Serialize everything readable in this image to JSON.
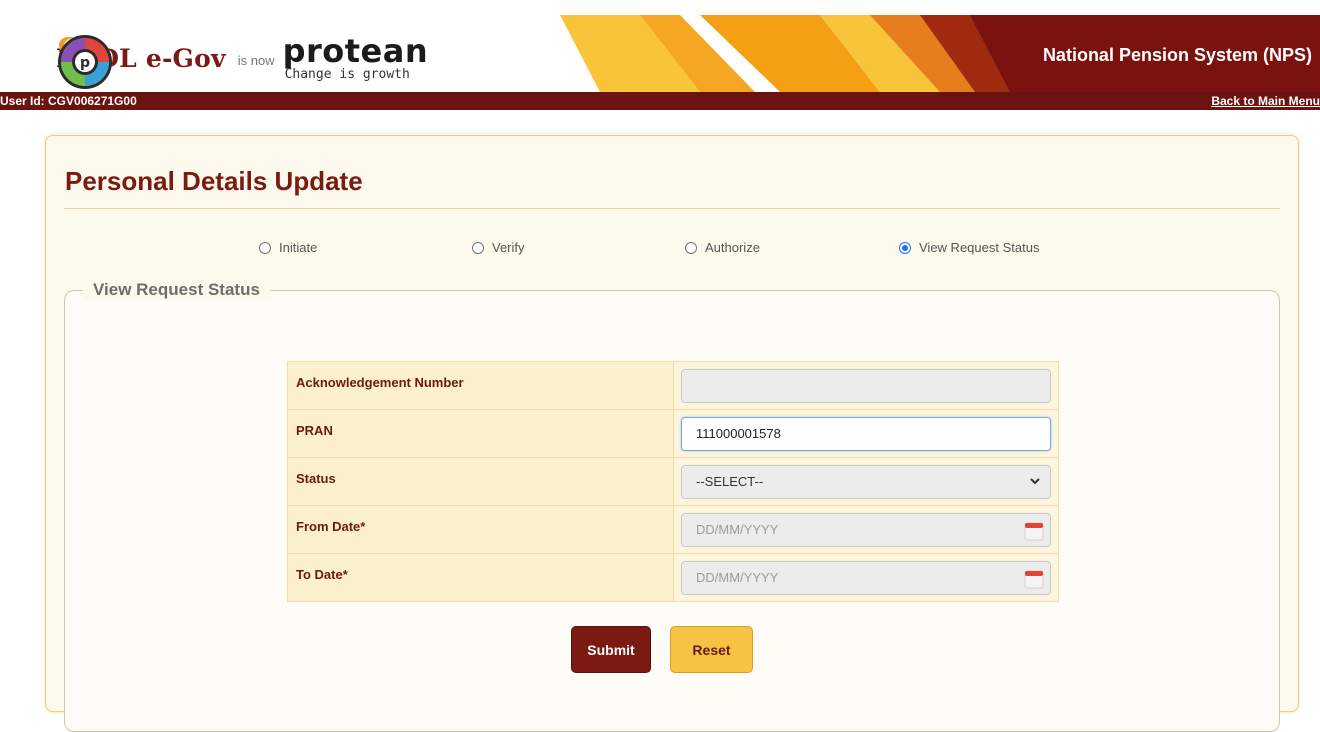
{
  "header": {
    "nsdl_brand_part1": "NSDL ",
    "nsdl_brand_part2": "e-Gov",
    "is_now": "is now",
    "protean_name": "protean",
    "protean_tagline": "Change is growth",
    "system_title": "National Pension System (NPS)"
  },
  "userbar": {
    "user_id": "User Id: CGV006271G00",
    "back_link": "Back to Main Menu"
  },
  "page": {
    "title": "Personal Details Update"
  },
  "modes": [
    {
      "label": "Initiate",
      "checked": false
    },
    {
      "label": "Verify",
      "checked": false
    },
    {
      "label": "Authorize",
      "checked": false
    },
    {
      "label": "View Request Status",
      "checked": true
    }
  ],
  "section": {
    "legend": "View Request Status"
  },
  "form": {
    "ack_label": "Acknowledgement Number",
    "ack_value": "",
    "pran_label": "PRAN",
    "pran_value": "111000001578",
    "status_label": "Status",
    "status_selected": "--SELECT--",
    "from_label": "From Date*",
    "from_placeholder": "DD/MM/YYYY",
    "to_label": "To Date*",
    "to_placeholder": "DD/MM/YYYY"
  },
  "buttons": {
    "submit": "Submit",
    "reset": "Reset"
  },
  "colors": {
    "brand_maroon": "#7a1a12",
    "accent_yellow": "#f6c344",
    "radio_blue": "#1a73e8"
  }
}
